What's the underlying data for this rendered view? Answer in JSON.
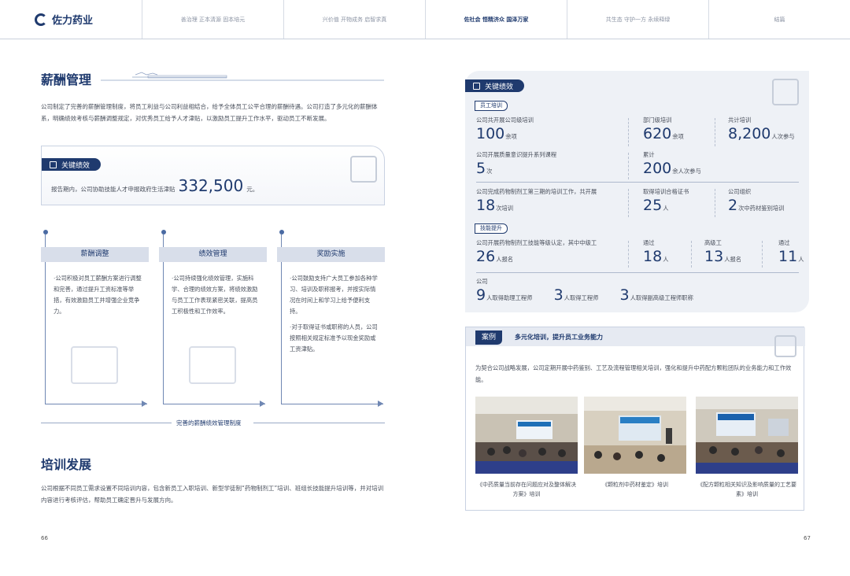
{
  "nav": {
    "brand": "佐力药业",
    "tabs": [
      "善治理 正本清源 固本培元",
      "兴价值 开物成务 启智求真",
      "佐社会 悟精济众 国泽万家",
      "共生态 守护一方 永续释绿",
      "结篇"
    ],
    "active_index": 2
  },
  "left": {
    "salary_title": "薪酬管理",
    "salary_para": "公司制定了完善的薪酬管理制度，将员工利益与公司利益相结合，给予全体员工公平合理的薪酬待遇。公司打造了多元化的薪酬体系，明确绩效考核与薪酬调整规定，对优秀员工给予人才津贴，以激励员工提升工作水平，驱动员工不断发展。",
    "kp_label": "关键绩效",
    "kp_text": "报告期内，公司协助技能人才申报政府生活津贴",
    "kp_value": "332,500",
    "kp_unit": "元。",
    "columns": [
      {
        "title": "薪酬调整",
        "paras": [
          "·公司积极对员工薪酬方案进行调整和完善，通过提升工资标准等举措，有效激励员工并增强企业竞争力。"
        ]
      },
      {
        "title": "绩效管理",
        "paras": [
          "·公司持续强化绩效管理，实施科学、合理的绩效方案，将绩效激励与员工工作表现紧密关联，提高员工积极性和工作效率。"
        ]
      },
      {
        "title": "奖励实施",
        "paras": [
          "·公司鼓励支持广大员工参加各种学习、培训及职称报考，并按实际情况在时间上和学习上给予便利支持。",
          "·对于取得证书或职称的人员，公司按照相关规定标准予以现金奖励或工资津贴。"
        ]
      }
    ],
    "caption": "完善的薪酬绩效管理制度",
    "training_title": "培训发展",
    "training_para": "公司根据不同员工需求设置不同培训内容，包含新员工入职培训、新型学徒制“药物制剂工”培训、班组长技能提升培训等，并对培训内容进行考核评估，帮助员工确定晋升与发展方向。",
    "page": "66"
  },
  "right": {
    "kp_label": "关键绩效",
    "sub1": "员工培训",
    "sub2": "技能提升",
    "cells": {
      "a1": {
        "label": "公司共开展公司级培训",
        "num": "100",
        "unit": "余项"
      },
      "a2": {
        "label": "部门级培训",
        "num": "620",
        "unit": "余项"
      },
      "a3": {
        "label": "共计培训",
        "num": "8,200",
        "unit": "人次参与"
      },
      "b1": {
        "label": "公司开展质量意识提升系列课程",
        "num": "5",
        "unit": "次"
      },
      "b2": {
        "label": "累计",
        "num": "200",
        "unit": "余人次参与"
      },
      "c1": {
        "label": "公司完成药物制剂工第三期的培训工作，共开展",
        "num": "18",
        "unit": "次培训"
      },
      "c2": {
        "label": "取得培训合格证书",
        "num": "25",
        "unit": "人"
      },
      "c3": {
        "label": "公司组织",
        "num": "2",
        "unit": "次中药材鉴别培训"
      },
      "d1": {
        "label": "公司开展药物制剂工技能等级认定，其中中级工",
        "num": "26",
        "unit": "人报名"
      },
      "d2": {
        "label": "通过",
        "num": "18",
        "unit": "人"
      },
      "d3": {
        "label": "高级工",
        "num": "13",
        "unit": "人报名"
      },
      "d4": {
        "label": "通过",
        "num": "11",
        "unit": "人"
      },
      "e0": {
        "label": "公司"
      },
      "e1": {
        "num": "9",
        "unit": "人取得助理工程师"
      },
      "e2": {
        "num": "3",
        "unit": "人取得工程师"
      },
      "e3": {
        "num": "3",
        "unit": "人取得副高级工程师职称"
      }
    },
    "case": {
      "tag": "案例",
      "title": "多元化培训，提升员工业务能力",
      "desc": "为契合公司战略发展，公司定期开展中药鉴别、工艺及流程管理相关培训，强化和提升中药配方颗粒团队的业务能力和工作效能。",
      "captions": [
        "《中药质量当前存在问题应对及整体解决方案》培训",
        "《颗粒剂中药材鉴定》培训",
        "《配方颗粒相关知识及影响质量的工艺要素》培训"
      ]
    },
    "page": "67"
  },
  "colors": {
    "brand": "#1f3a6e",
    "panel": "#eef1f6",
    "line": "#6f87b3"
  }
}
